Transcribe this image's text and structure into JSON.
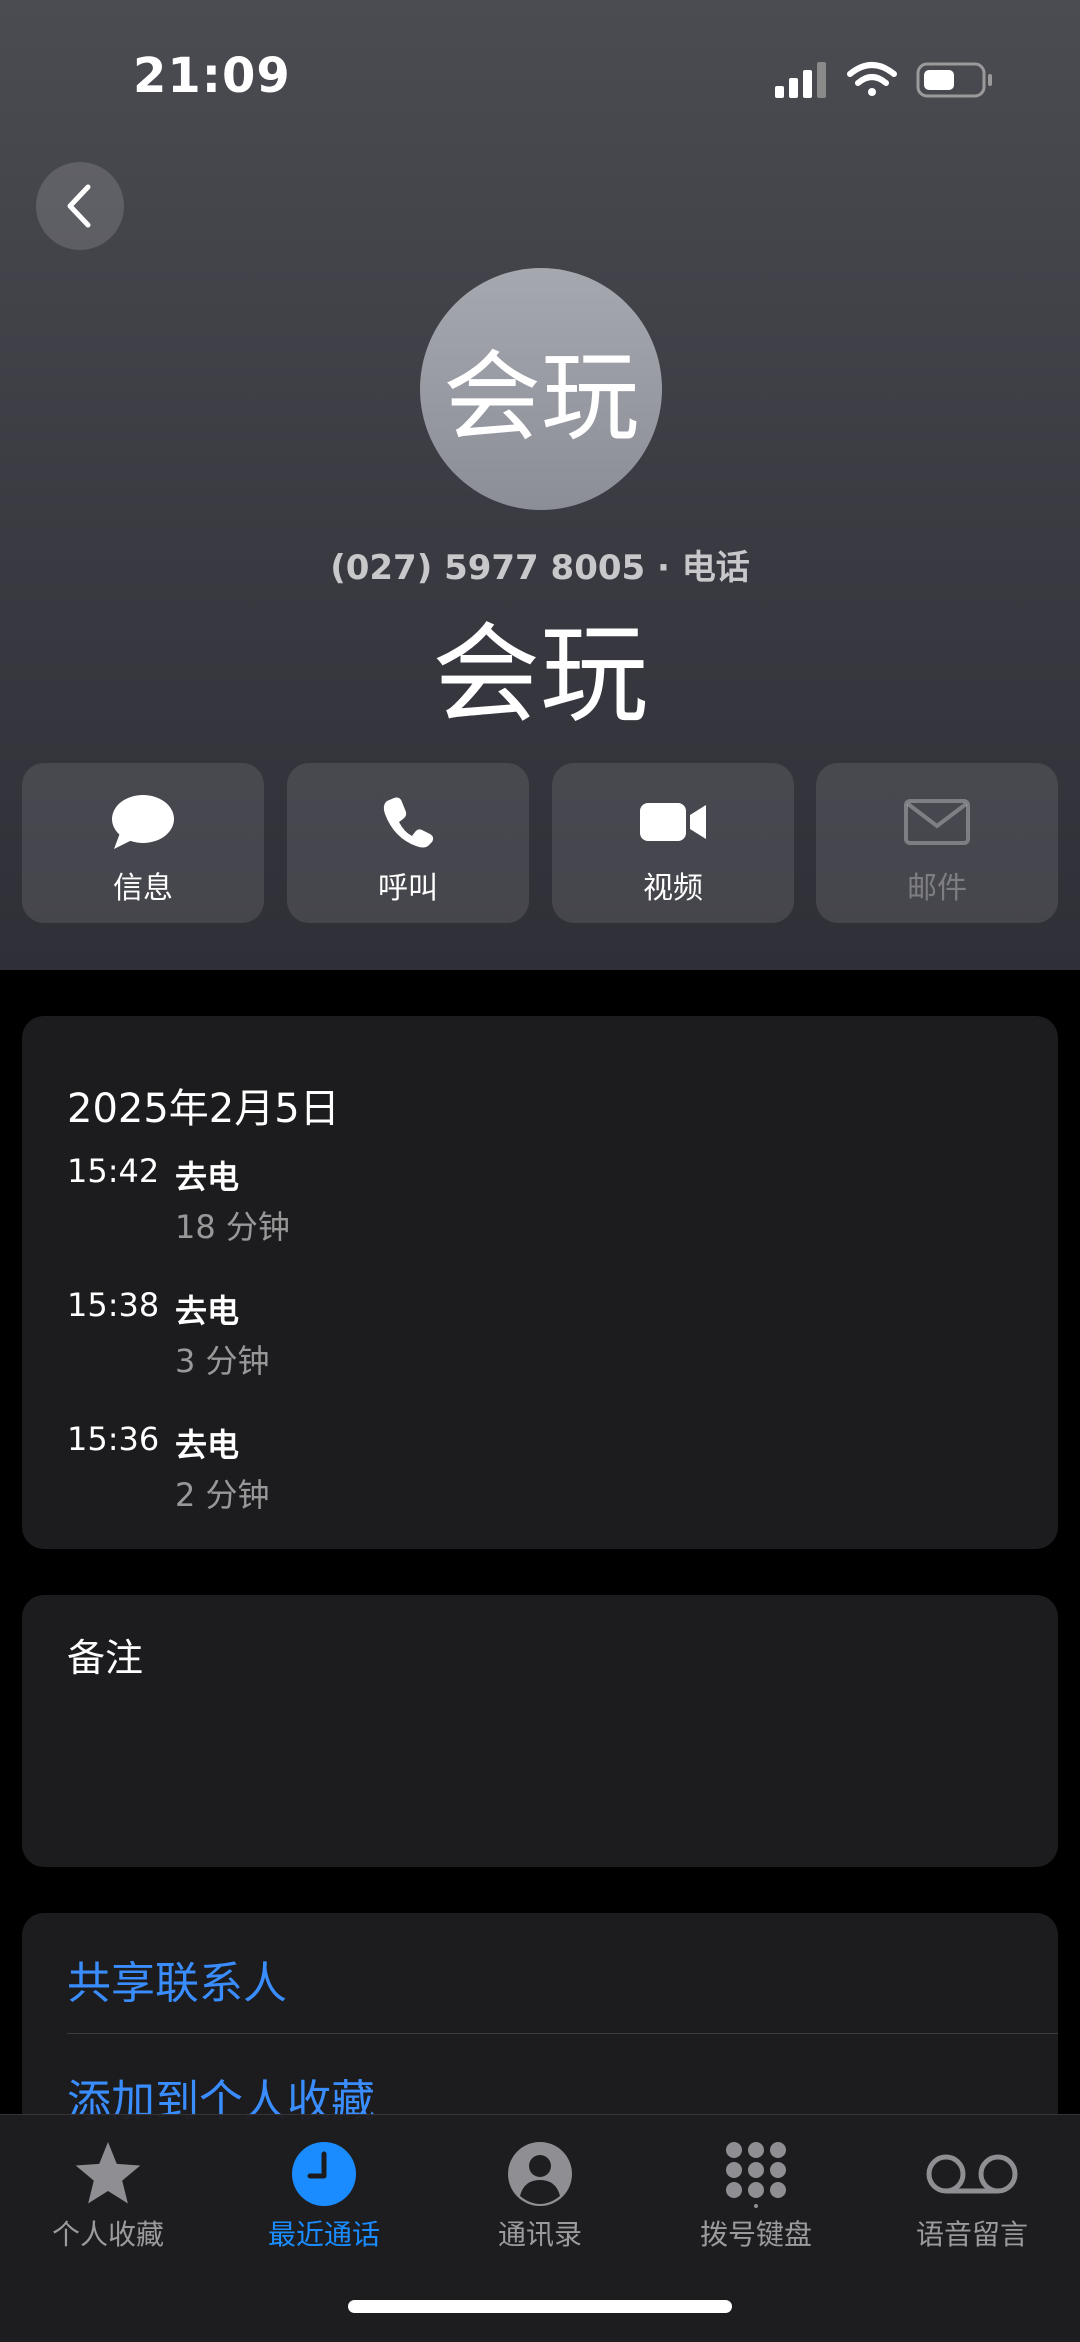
{
  "status_bar": {
    "time": "21:09"
  },
  "contact": {
    "avatar_text": "会玩",
    "phone": "(027) 5977 8005",
    "phone_label": "电话",
    "separator": " · ",
    "name": "会玩"
  },
  "actions": [
    {
      "label": "信息",
      "icon": "message-bubble-icon",
      "enabled": true
    },
    {
      "label": "呼叫",
      "icon": "phone-icon",
      "enabled": true
    },
    {
      "label": "视频",
      "icon": "video-camera-icon",
      "enabled": true
    },
    {
      "label": "邮件",
      "icon": "envelope-icon",
      "enabled": false
    }
  ],
  "call_history": {
    "date": "2025年2月5日",
    "calls": [
      {
        "time": "15:42",
        "type": "去电",
        "duration": "18 分钟"
      },
      {
        "time": "15:38",
        "type": "去电",
        "duration": "3 分钟"
      },
      {
        "time": "15:36",
        "type": "去电",
        "duration": "2 分钟"
      }
    ]
  },
  "notes": {
    "label": "备注"
  },
  "links": {
    "share_contact": "共享联系人",
    "add_favorite": "添加到个人收藏"
  },
  "tabs": [
    {
      "label": "个人收藏",
      "icon": "star-icon",
      "active": false
    },
    {
      "label": "最近通话",
      "icon": "clock-icon",
      "active": true
    },
    {
      "label": "通讯录",
      "icon": "person-circle-icon",
      "active": false
    },
    {
      "label": "拨号键盘",
      "icon": "keypad-icon",
      "active": false
    },
    {
      "label": "语音留言",
      "icon": "voicemail-icon",
      "active": false
    }
  ],
  "colors": {
    "accent": "#1a8cff",
    "link": "#3a8dff",
    "card_bg": "#1c1c1e"
  }
}
